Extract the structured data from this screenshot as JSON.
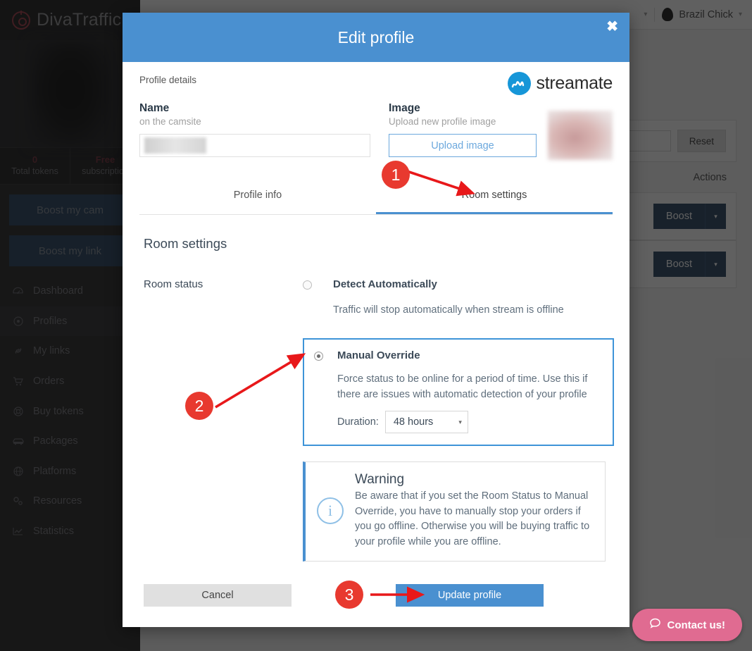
{
  "app": {
    "brand": "DivaTraffic",
    "user": {
      "name": "Brazil Chick",
      "caret": "▾"
    },
    "stats": [
      {
        "value": "0",
        "label": "Total tokens"
      },
      {
        "value": "Free",
        "label": "subscription"
      }
    ],
    "quick_actions": [
      {
        "label": "Boost my cam"
      },
      {
        "label": "Boost my link"
      }
    ],
    "nav": [
      {
        "label": "Dashboard",
        "icon": "dashboard-icon"
      },
      {
        "label": "Profiles",
        "icon": "profiles-icon"
      },
      {
        "label": "My links",
        "icon": "link-icon"
      },
      {
        "label": "Orders",
        "icon": "cart-icon"
      },
      {
        "label": "Buy tokens",
        "icon": "token-icon"
      },
      {
        "label": "Packages",
        "icon": "package-icon"
      },
      {
        "label": "Platforms",
        "icon": "globe-icon"
      },
      {
        "label": "Resources",
        "icon": "gears-icon"
      },
      {
        "label": "Statistics",
        "icon": "chart-icon"
      }
    ],
    "background": {
      "reset_label": "Reset",
      "filter_value": "",
      "actions_header": "Actions",
      "rows": [
        {
          "boost_label": "Boost",
          "caret": "▾"
        },
        {
          "boost_label": "Boost",
          "caret": "▾"
        }
      ]
    },
    "contact_widget": {
      "label": "Contact us!",
      "icon": "chat-bubble-icon",
      "color": "#e06b91"
    }
  },
  "modal": {
    "title": "Edit profile",
    "close_label": "✖",
    "header_color": "#4a90d0",
    "section_label": "Profile details",
    "site_logo": {
      "text": "streamate",
      "color": "#1696d8"
    },
    "fields": {
      "name": {
        "title": "Name",
        "subtitle": "on the camsite",
        "value": "",
        "placeholder": ""
      },
      "image": {
        "title": "Image",
        "subtitle": "Upload new profile image",
        "upload_label": "Upload image"
      }
    },
    "tabs": [
      {
        "label": "Profile info",
        "active": false
      },
      {
        "label": "Room settings",
        "active": true
      }
    ],
    "room_settings": {
      "heading": "Room settings",
      "status_label": "Room status",
      "options": [
        {
          "title": "Detect Automatically",
          "description": "Traffic will stop automatically when stream is offline",
          "selected": false
        },
        {
          "title": "Manual Override",
          "description": "Force status to be online for a period of time. Use this if there are issues with automatic detection of your profile",
          "selected": true,
          "duration_label": "Duration:",
          "duration_value": "48 hours",
          "duration_caret": "▾"
        }
      ],
      "warning": {
        "title": "Warning",
        "text": "Be aware that if you set the Room Status to Manual Override, you have to manually stop your orders if you go offline. Otherwise you will be buying traffic to your profile while you are offline.",
        "icon": "info-circle-icon"
      }
    },
    "footer": {
      "cancel_label": "Cancel",
      "update_label": "Update profile"
    }
  },
  "annotations": {
    "color": "#e8392f",
    "steps": [
      {
        "number": "1",
        "target": "room-settings-tab"
      },
      {
        "number": "2",
        "target": "manual-override-radio"
      },
      {
        "number": "3",
        "target": "update-profile-button"
      }
    ]
  }
}
